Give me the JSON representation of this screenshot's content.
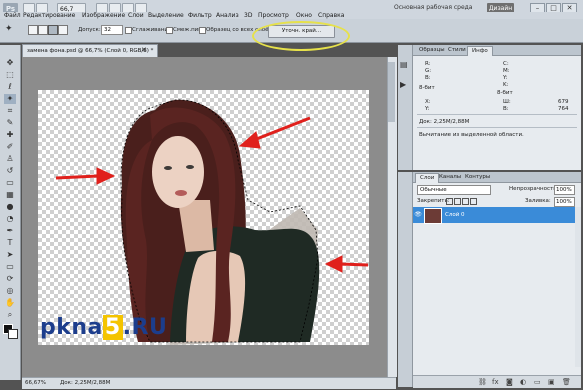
{
  "menubar": {
    "logo": "Ps",
    "zoom": "66,7",
    "items": [
      "Файл",
      "Редактирование",
      "Изображение",
      "Слои",
      "Выделение",
      "Фильтр",
      "Анализ",
      "3D",
      "Просмотр",
      "Окно",
      "Справка"
    ],
    "workspace": "Основная рабочая среда",
    "design_button": "Дизайн",
    "win_controls": [
      "–",
      "□",
      "✕"
    ]
  },
  "options": {
    "tolerance_label": "Допуск:",
    "tolerance_value": "32",
    "antialias_label": "Сглаживание",
    "contiguous_label": "Смеж.пикс",
    "all_layers_label": "Образец со всех слоёв",
    "refine_button": "Уточн. край..."
  },
  "document": {
    "tab": "замена фона.psd @ 66,7% (Слой 0, RGB/8) *",
    "status_zoom": "66,67%",
    "status_doc": "Док: 2,25М/2,88М"
  },
  "watermark": {
    "prefix": "pkna",
    "five": "5",
    "suffix": ".RU"
  },
  "info_panel": {
    "tabs": [
      "Образцы",
      "Стили",
      "Инфо"
    ],
    "active_tab": "Инфо",
    "left_labels": [
      "R:",
      "G:",
      "B:"
    ],
    "right_labels": [
      "C:",
      "M:",
      "Y:",
      "K:"
    ],
    "bit_left": "8-бит",
    "bit_right": "8-бит",
    "x_label": "X:",
    "y_label": "Y:",
    "w_label": "Ш:",
    "h_label": "В:",
    "w_value": "679",
    "h_value": "764",
    "doc_size": "Док: 2,25М/2,88М",
    "hint": "Вычитание из выделенной области."
  },
  "layers_panel": {
    "tabs": [
      "Слои",
      "Каналы",
      "Контуры"
    ],
    "active_tab": "Слои",
    "blend_mode": "Обычные",
    "opacity_label": "Непрозрачность:",
    "opacity_value": "100%",
    "lock_label": "Закрепить:",
    "fill_label": "Заливка:",
    "fill_value": "100%",
    "layer_name": "Слой 0"
  },
  "colors": {
    "highlight": "#e6e14b",
    "arrow": "#e0201c",
    "layer_selected": "#3a8bd8",
    "watermark_blue": "#1c3d8c",
    "watermark_yellow": "#f4c400"
  }
}
